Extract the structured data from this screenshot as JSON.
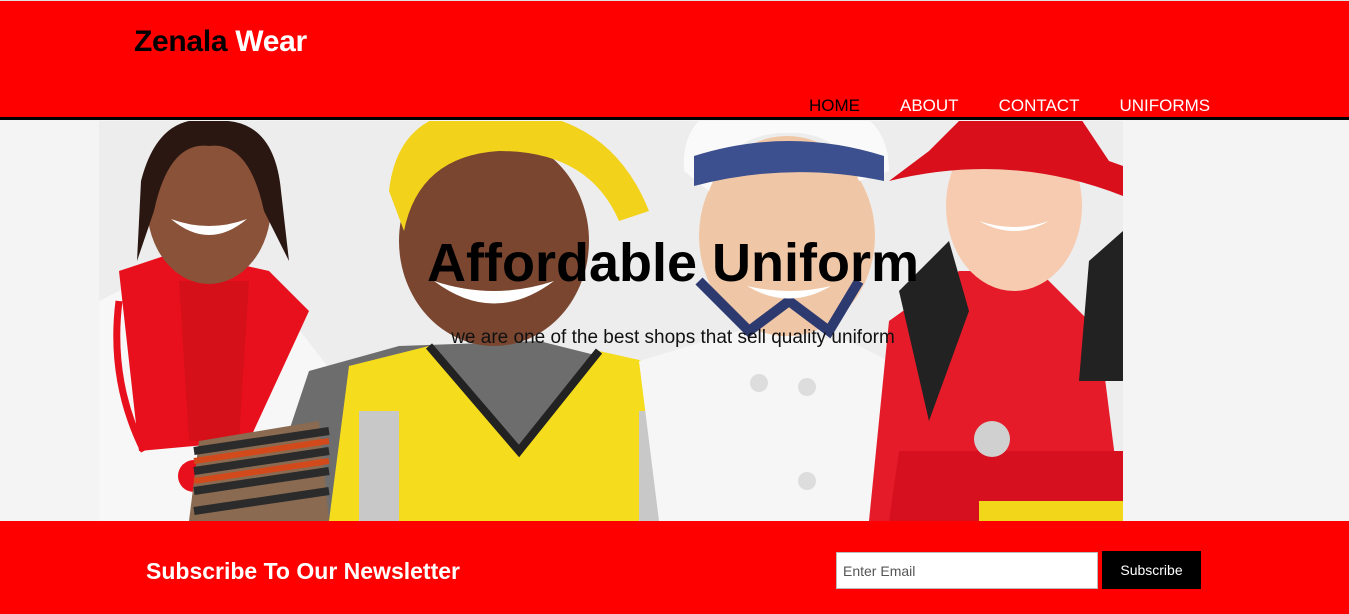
{
  "brand": {
    "name_part1": "Zenala",
    "name_part2": "Wear"
  },
  "nav": {
    "items": [
      {
        "label": "HOME",
        "active": true
      },
      {
        "label": "ABOUT",
        "active": false
      },
      {
        "label": "CONTACT",
        "active": false
      },
      {
        "label": "UNIFORMS",
        "active": false
      }
    ]
  },
  "hero": {
    "title": "Affordable Uniform",
    "subtitle": "we are one of the best shops that sell quality uniform"
  },
  "newsletter": {
    "title": "Subscribe To Our Newsletter",
    "email_placeholder": "Enter Email",
    "email_value": "",
    "button_label": "Subscribe"
  },
  "colors": {
    "primary": "#ff0000",
    "dark": "#000000",
    "light": "#ffffff"
  }
}
